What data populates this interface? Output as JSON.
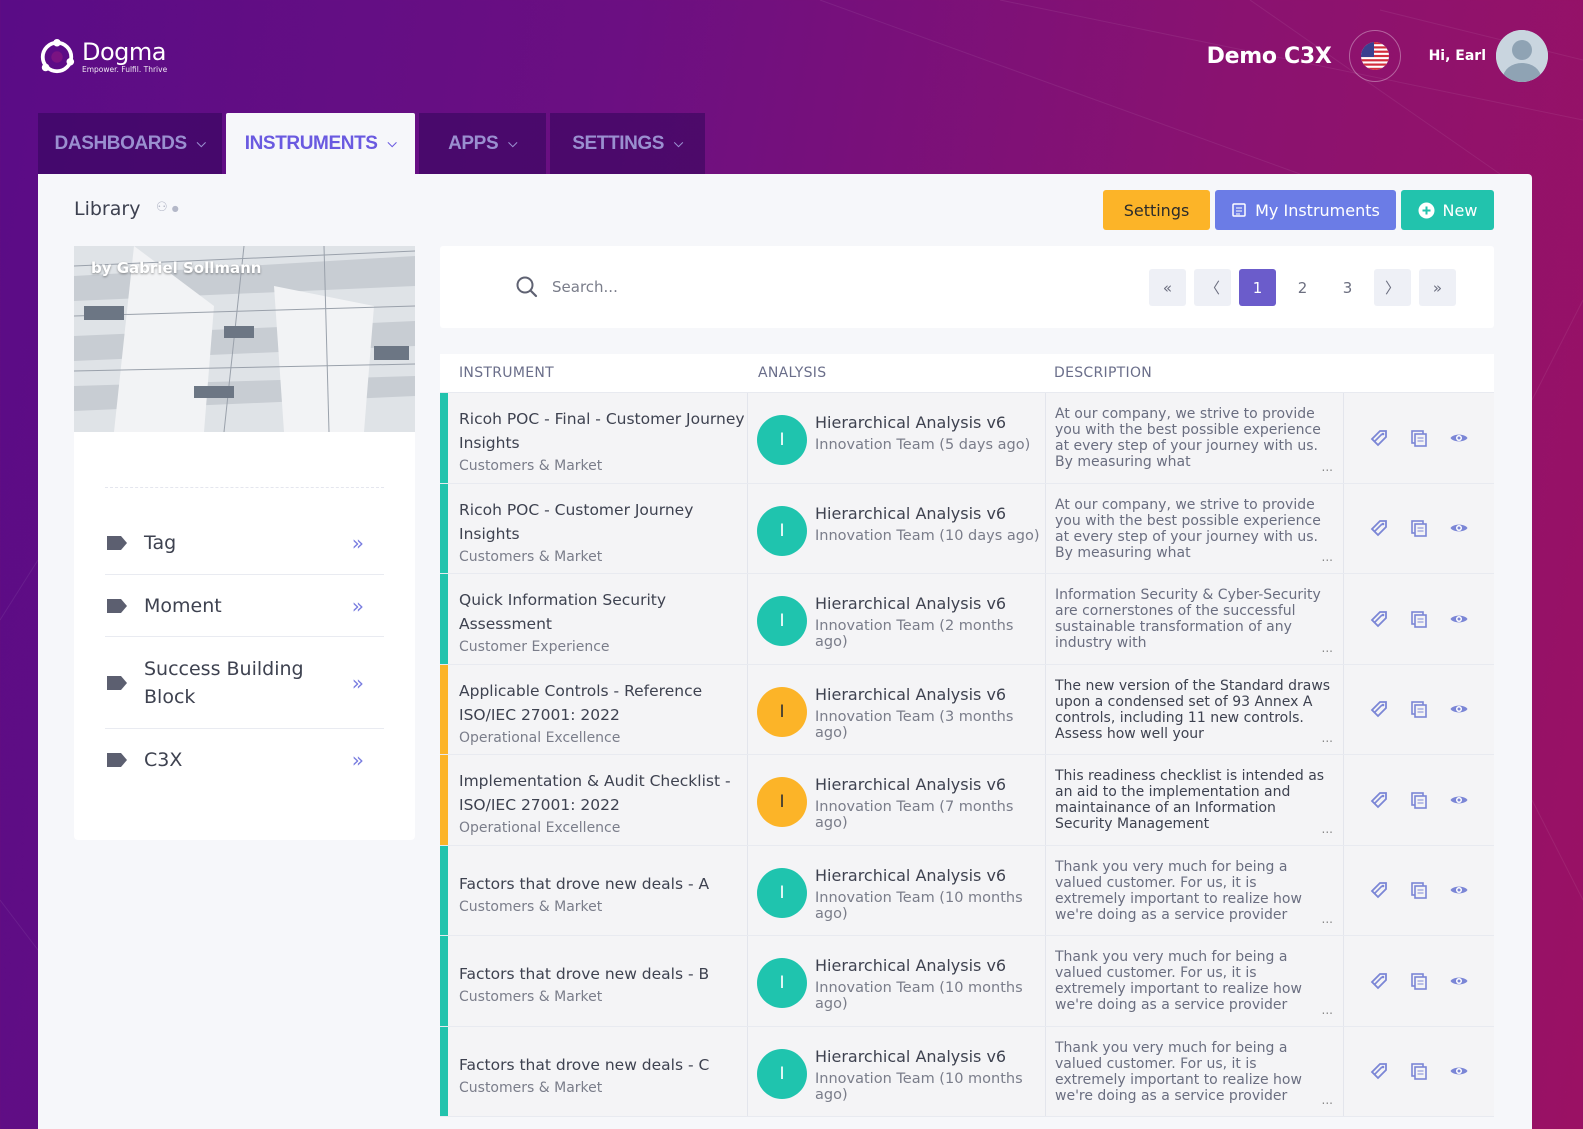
{
  "brand": {
    "name": "Dogma",
    "tagline": "Empower. Fulfil. Thrive"
  },
  "header": {
    "company": "Demo C3X",
    "greeting": "Hi,  Earl",
    "flag_icon": "us-flag-icon"
  },
  "nav": {
    "tabs": [
      {
        "label": "DASHBOARDS",
        "active": false
      },
      {
        "label": "INSTRUMENTS",
        "active": true
      },
      {
        "label": "APPS",
        "active": false
      },
      {
        "label": "SETTINGS",
        "active": false
      }
    ]
  },
  "page": {
    "title": "Library"
  },
  "toolbar": {
    "settings_label": "Settings",
    "my_instruments_label": "My Instruments",
    "new_label": "New"
  },
  "side": {
    "hero_credit": "by Gabriel Sollmann",
    "items": [
      {
        "label": "Tag"
      },
      {
        "label": "Moment"
      },
      {
        "label": "Success Building Block"
      },
      {
        "label": "C3X"
      }
    ]
  },
  "search": {
    "placeholder": "Search..."
  },
  "pagination": {
    "first": "«",
    "prev": "〈",
    "pages": [
      "1",
      "2",
      "3"
    ],
    "current": "1",
    "next": "〉",
    "last": "»"
  },
  "table": {
    "headers": [
      "INSTRUMENT",
      "ANALYSIS",
      "DESCRIPTION"
    ],
    "rows": [
      {
        "name": "Ricoh POC - Final - Customer Journey Insights",
        "category": "Customers & Market",
        "status": "teal",
        "initial": "I",
        "analysis": "Hierarchical Analysis v6",
        "team": "Innovation Team (5 days ago)",
        "description": "At our company, we strive to provide you with the best possible experience at every step of your journey with us. By measuring what"
      },
      {
        "name": "Ricoh POC - Customer Journey Insights",
        "category": "Customers & Market",
        "status": "teal",
        "initial": "I",
        "analysis": "Hierarchical Analysis v6",
        "team": "Innovation Team (10 days ago)",
        "description": "At our company, we strive to provide you with the best possible experience at every step of your journey with us. By measuring what"
      },
      {
        "name": "Quick Information Security Assessment",
        "category": "Customer Experience",
        "status": "teal",
        "initial": "I",
        "analysis": "Hierarchical Analysis v6",
        "team": "Innovation Team (2 months ago)",
        "description": "Information Security & Cyber-Security are cornerstones of the successful sustainable transformation of any industry with"
      },
      {
        "name": "Applicable Controls - Reference ISO/IEC 27001: 2022",
        "category": "Operational Excellence",
        "status": "amber",
        "initial": "I",
        "analysis": "Hierarchical Analysis v6",
        "team": "Innovation Team (3 months ago)",
        "description": "The new version of the Standard draws upon a condensed set of 93 Annex A controls, including 11 new controls. Assess how well your"
      },
      {
        "name": "Implementation & Audit Checklist - ISO/IEC 27001: 2022",
        "category": "Operational Excellence",
        "status": "amber",
        "initial": "I",
        "analysis": "Hierarchical Analysis v6",
        "team": "Innovation Team (7 months ago)",
        "description": "This readiness checklist is intended as an aid to the implementation and maintainance of an Information Security Management"
      },
      {
        "name": "Factors that drove new deals - A",
        "category": "Customers & Market",
        "status": "teal",
        "initial": "I",
        "analysis": "Hierarchical Analysis v6",
        "team": "Innovation Team (10 months ago)",
        "description": "Thank you very much for being a valued customer. For us, it is extremely important to realize how we're doing as a service provider"
      },
      {
        "name": "Factors that drove new deals - B",
        "category": "Customers & Market",
        "status": "teal",
        "initial": "I",
        "analysis": "Hierarchical Analysis v6",
        "team": "Innovation Team (10 months ago)",
        "description": "Thank you very much for being a valued customer. For us, it is extremely important to realize how we're doing as a service provider"
      },
      {
        "name": "Factors that drove new deals - C",
        "category": "Customers & Market",
        "status": "teal",
        "initial": "I",
        "analysis": "Hierarchical Analysis v6",
        "team": "Innovation Team (10 months ago)",
        "description": "Thank you very much for being a valued customer. For us, it is extremely important to realize how we're doing as a service provider"
      }
    ],
    "row_actions": [
      "tag-edit-icon",
      "copy-icon",
      "eye-icon"
    ],
    "more_indicator": "..."
  },
  "colors": {
    "teal": "#22c3ad",
    "amber": "#fcb428",
    "accent": "#6b5ccb",
    "blue": "#6b7ce6"
  }
}
